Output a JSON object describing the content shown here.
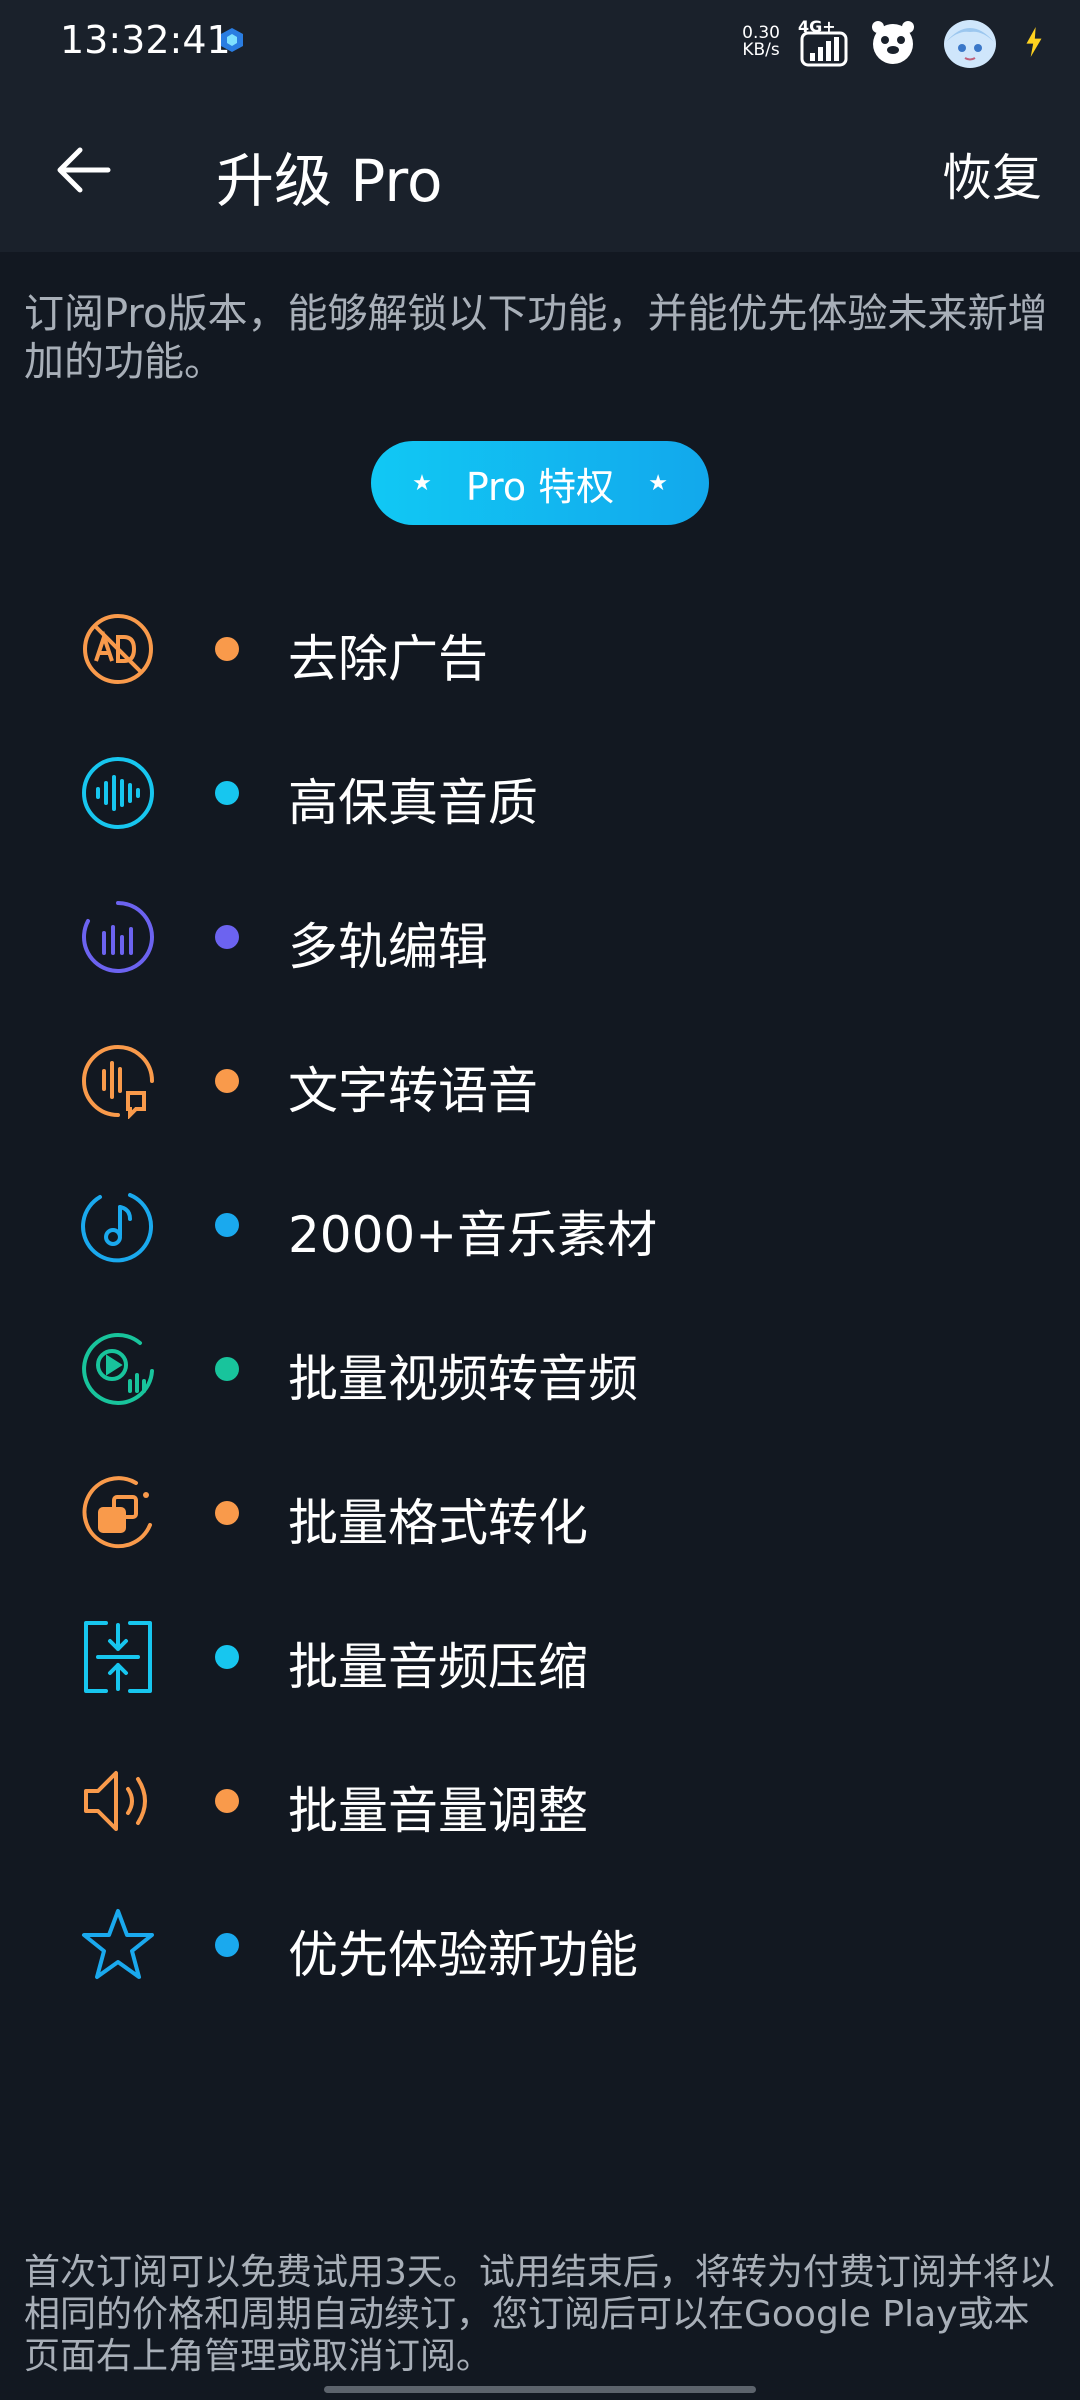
{
  "status_bar": {
    "time": "13:32:41",
    "net_speed_value": "0.30",
    "net_speed_unit": "KB/s",
    "network": "4G+",
    "icons": [
      "app-notification-icon",
      "signal-icon",
      "paw-icon",
      "anime-avatar-sticker",
      "charging-icon"
    ]
  },
  "header": {
    "title": "升级 Pro",
    "restore_label": "恢复",
    "back_icon": "arrow-left-icon"
  },
  "intro_text": "订阅Pro版本，能够解锁以下功能，并能优先体验未来新增加的功能。",
  "pro_badge": {
    "label": "Pro 特权"
  },
  "features": [
    {
      "label": "去除广告",
      "icon": "no-ads-icon",
      "color": "#f99a4b"
    },
    {
      "label": "高保真音质",
      "icon": "waveform-icon",
      "color": "#17c6ef"
    },
    {
      "label": "多轨编辑",
      "icon": "multitrack-icon",
      "color": "#6c63f0"
    },
    {
      "label": "文字转语音",
      "icon": "text-to-speech-icon",
      "color": "#f99a4b"
    },
    {
      "label": "2000+音乐素材",
      "icon": "music-note-icon",
      "color": "#1aa9ee"
    },
    {
      "label": "批量视频转音频",
      "icon": "video-to-audio-icon",
      "color": "#18c49c"
    },
    {
      "label": "批量格式转化",
      "icon": "format-convert-icon",
      "color": "#f99a4b"
    },
    {
      "label": "批量音频压缩",
      "icon": "compress-icon",
      "color": "#17c6ef"
    },
    {
      "label": "批量音量调整",
      "icon": "volume-icon",
      "color": "#f99a4b"
    },
    {
      "label": "优先体验新功能",
      "icon": "star-icon",
      "color": "#1aa9ee"
    }
  ],
  "footer_text": "首次订阅可以免费试用3天。试用结束后，将转为付费订阅并将以相同的价格和周期自动续订，您订阅后可以在Google Play或本页面右上角管理或取消订阅。"
}
